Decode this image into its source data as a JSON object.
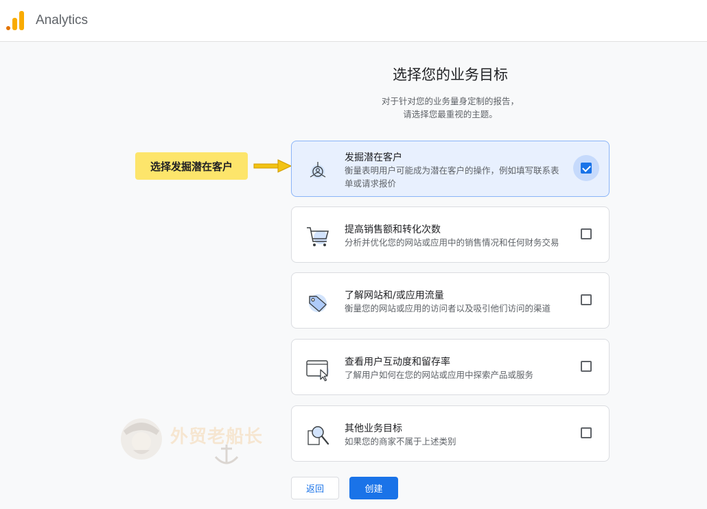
{
  "app": {
    "title": "Analytics",
    "logo_colors": [
      "#f9ab00",
      "#e37400"
    ]
  },
  "page": {
    "heading": "选择您的业务目标",
    "subtitle_lines": [
      "对于针对您的业务量身定制的报告，",
      "请选择您最重视的主题。"
    ]
  },
  "annotation": {
    "callout": "选择发掘潜在客户",
    "color": "#fde56b"
  },
  "objectives": [
    {
      "title": "发掘潜在客户",
      "description_lines": [
        "衡量表明用户可能成为潜在客户的操作，例如填写联系表",
        "单或请求报价"
      ],
      "icon": "lead-target-icon",
      "checked": true
    },
    {
      "title": "提高销售额和转化次数",
      "description_lines": [
        "分析并优化您的网站或应用中的销售情况和任何财务交易"
      ],
      "icon": "shopping-cart-icon",
      "checked": false
    },
    {
      "title": "了解网站和/或应用流量",
      "description_lines": [
        "衡量您的网站或应用的访问者以及吸引他们访问的渠道"
      ],
      "icon": "tag-icon",
      "checked": false
    },
    {
      "title": "查看用户互动度和留存率",
      "description_lines": [
        "了解用户如何在您的网站或应用中探索产品或服务"
      ],
      "icon": "browser-cursor-icon",
      "checked": false
    },
    {
      "title": "其他业务目标",
      "description_lines": [
        "如果您的商家不属于上述类别"
      ],
      "icon": "magnifier-icon",
      "checked": false
    }
  ],
  "buttons": {
    "back": "返回",
    "create": "创建"
  },
  "watermark": {
    "text": "外贸老船长"
  },
  "colors": {
    "accent": "#1a73e8",
    "selected_card_bg": "#e8f0fe"
  }
}
